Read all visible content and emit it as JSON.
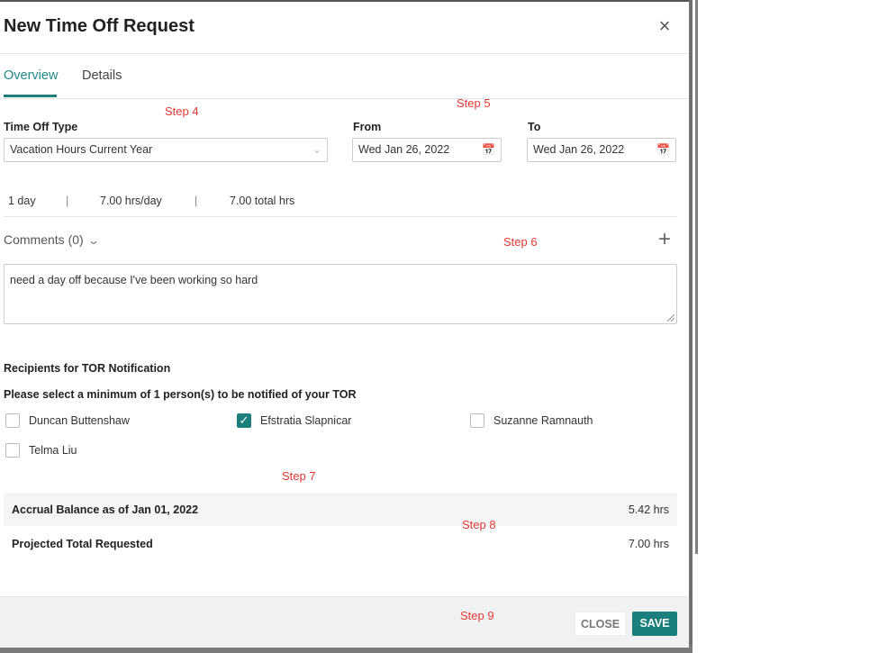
{
  "dialog": {
    "title": "New Time Off Request",
    "close_icon": "×"
  },
  "tabs": [
    {
      "label": "Overview",
      "active": true
    },
    {
      "label": "Details",
      "active": false
    }
  ],
  "annotations": {
    "step4": "Step 4",
    "step5": "Step 5",
    "step6": "Step 6",
    "step7": "Step 7",
    "step8": "Step 8",
    "step9": "Step 9"
  },
  "form": {
    "time_off_type": {
      "label": "Time Off Type",
      "value": "Vacation Hours Current Year",
      "icon": "chevron-down-icon"
    },
    "from": {
      "label": "From",
      "value": "Wed Jan 26, 2022",
      "icon": "calendar-icon"
    },
    "to": {
      "label": "To",
      "value": "Wed Jan 26, 2022",
      "icon": "calendar-icon"
    }
  },
  "summary": {
    "days": "1 day",
    "separator": "|",
    "hrs_per_day": "7.00 hrs/day",
    "total_hrs": "7.00 total hrs"
  },
  "comments": {
    "label": "Comments (0)",
    "add_icon": "+",
    "text": "need a day off because I've been working so hard"
  },
  "recipients": {
    "title": "Recipients for TOR Notification",
    "instruction": "Please select a minimum of 1 person(s) to be notified of your TOR",
    "people": [
      {
        "name": "Duncan Buttenshaw",
        "checked": false
      },
      {
        "name": "Efstratia Slapnicar",
        "checked": true
      },
      {
        "name": "Suzanne Ramnauth",
        "checked": false
      },
      {
        "name": "Telma Liu",
        "checked": false
      }
    ]
  },
  "balance": {
    "accrual_label": "Accrual Balance as of Jan 01, 2022",
    "accrual_value": "5.42 hrs",
    "projected_label": "Projected Total Requested",
    "projected_value": "7.00 hrs"
  },
  "footer": {
    "close_label": "CLOSE",
    "save_label": "SAVE"
  },
  "colors": {
    "accent": "#1b7f7c",
    "annotation": "#e53935"
  }
}
